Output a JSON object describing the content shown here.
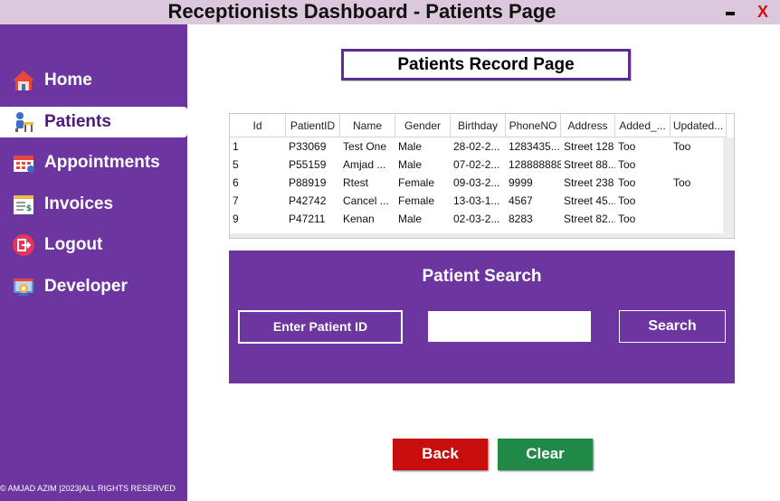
{
  "window": {
    "title": "Receptionists Dashboard - Patients Page",
    "minimize_label": "",
    "close_label": "X"
  },
  "sidebar": {
    "items": [
      {
        "label": "Home",
        "icon": "home-icon"
      },
      {
        "label": "Patients",
        "icon": "patient-icon",
        "active": true
      },
      {
        "label": "Appointments",
        "icon": "calendar-icon"
      },
      {
        "label": "Invoices",
        "icon": "invoice-icon"
      },
      {
        "label": "Logout",
        "icon": "logout-icon"
      },
      {
        "label": "Developer",
        "icon": "developer-icon"
      }
    ],
    "copyright": "© AMJAD AZIM |2023|ALL RIGHTS RESERVED"
  },
  "page_heading": "Patients Record Page",
  "table": {
    "columns": [
      "Id",
      "PatientID",
      "Name",
      "Gender",
      "Birthday",
      "PhoneNO",
      "Address",
      "Added_...",
      "Updated..."
    ],
    "rows": [
      [
        "1",
        "P33069",
        "Test One",
        "Male",
        "28-02-2...",
        "1283435...",
        "Street 128",
        "Too",
        "Too"
      ],
      [
        "5",
        "P55159",
        "Amjad ...",
        "Male",
        "07-02-2...",
        "128888888",
        "Street 88...",
        "Too",
        ""
      ],
      [
        "6",
        "P88919",
        "Rtest",
        "Female",
        "09-03-2...",
        "9999",
        "Street 238",
        "Too",
        "Too"
      ],
      [
        "7",
        "P42742",
        "Cancel ...",
        "Female",
        "13-03-1...",
        "4567",
        "Street 45...",
        "Too",
        ""
      ],
      [
        "9",
        "P47211",
        "Kenan",
        "Male",
        "02-03-2...",
        "8283",
        "Street 82...",
        "Too",
        ""
      ]
    ]
  },
  "search": {
    "title": "Patient Search",
    "field_label": "Enter Patient ID",
    "input_value": "",
    "button_label": "Search"
  },
  "actions": {
    "back_label": "Back",
    "clear_label": "Clear"
  },
  "colors": {
    "sidebar": "#6c35a0",
    "titlebar": "#dcc8dc",
    "back": "#c80d0d",
    "clear": "#1f8a48"
  }
}
